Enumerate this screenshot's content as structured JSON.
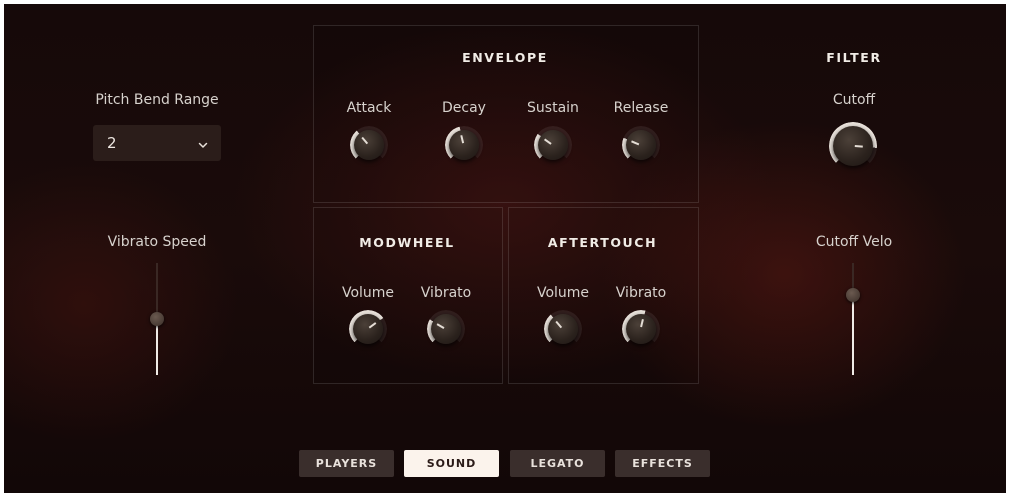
{
  "pitch_bend": {
    "label": "Pitch Bend Range",
    "value": "2"
  },
  "vibrato_speed": {
    "label": "Vibrato Speed",
    "level": 0.5
  },
  "envelope": {
    "title": "ENVELOPE",
    "knobs": [
      {
        "label": "Attack",
        "value": 0.35
      },
      {
        "label": "Decay",
        "value": 0.45
      },
      {
        "label": "Sustain",
        "value": 0.3
      },
      {
        "label": "Release",
        "value": 0.25
      }
    ]
  },
  "modwheel": {
    "title": "MODWHEEL",
    "knobs": [
      {
        "label": "Volume",
        "value": 0.7
      },
      {
        "label": "Vibrato",
        "value": 0.28
      }
    ]
  },
  "aftertouch": {
    "title": "AFTERTOUCH",
    "knobs": [
      {
        "label": "Volume",
        "value": 0.35
      },
      {
        "label": "Vibrato",
        "value": 0.55
      }
    ]
  },
  "filter": {
    "title": "FILTER",
    "cutoff_label": "Cutoff",
    "cutoff_value": 0.85,
    "cutoff_velo_label": "Cutoff Velo",
    "cutoff_velo_level": 0.75
  },
  "tabs": [
    {
      "label": "PLAYERS",
      "active": false
    },
    {
      "label": "SOUND",
      "active": true
    },
    {
      "label": "LEGATO",
      "active": false
    },
    {
      "label": "EFFECTS",
      "active": false
    }
  ],
  "colors": {
    "background": "#1a0b0a",
    "accent": "#f0ebe6",
    "tab_inactive": "#3a2e2c",
    "tab_active": "#fbf3ec"
  }
}
